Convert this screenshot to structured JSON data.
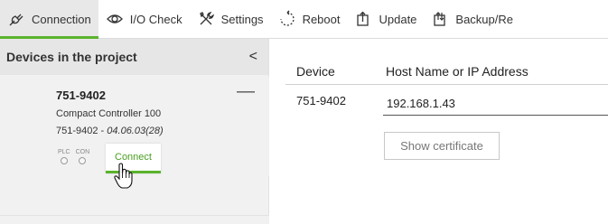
{
  "toolbar": {
    "items": [
      {
        "label": "Connection",
        "icon": "connection-plug-icon",
        "active": true
      },
      {
        "label": "I/O Check",
        "icon": "eye-icon",
        "active": false
      },
      {
        "label": "Settings",
        "icon": "tools-icon",
        "active": false
      },
      {
        "label": "Reboot",
        "icon": "reboot-icon",
        "active": false
      },
      {
        "label": "Update",
        "icon": "update-icon",
        "active": false
      },
      {
        "label": "Backup/Re",
        "icon": "backup-icon",
        "active": false
      }
    ],
    "accent_color": "#5ab32b"
  },
  "left_panel": {
    "title": "Devices in the project",
    "collapse_glyph": "<",
    "device": {
      "name": "751-9402",
      "description": "Compact Controller 100",
      "article": "751-9402",
      "separator": " - ",
      "version": "04.06.03(28)",
      "remove_glyph": "—",
      "leds": [
        "PLC",
        "CON"
      ],
      "connect_label": "Connect"
    }
  },
  "right_panel": {
    "headers": {
      "device": "Device",
      "host": "Host Name or IP Address"
    },
    "row": {
      "device": "751-9402",
      "host_value": "192.168.1.43"
    },
    "show_certificate_label": "Show certificate"
  }
}
